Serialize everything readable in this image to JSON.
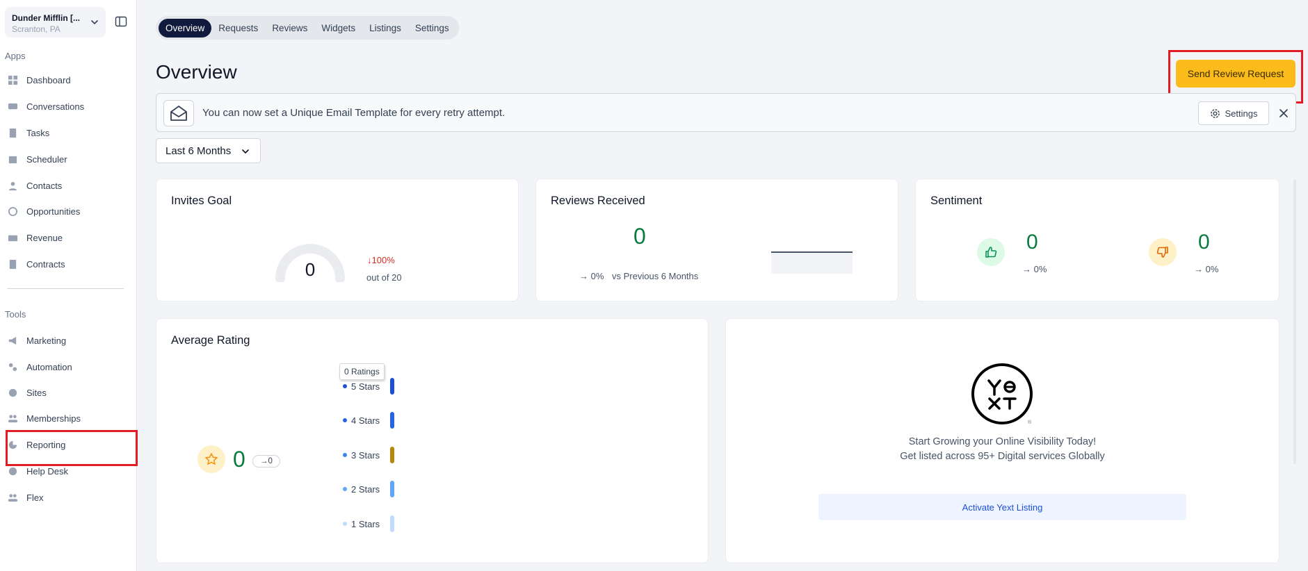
{
  "location": {
    "name": "Dunder Mifflin [...",
    "city": "Scranton, PA"
  },
  "sidebar": {
    "apps_label": "Apps",
    "tools_label": "Tools",
    "apps": [
      {
        "label": "Dashboard",
        "icon": "dashboard-icon"
      },
      {
        "label": "Conversations",
        "icon": "conversations-icon"
      },
      {
        "label": "Tasks",
        "icon": "tasks-icon"
      },
      {
        "label": "Scheduler",
        "icon": "calendar-icon"
      },
      {
        "label": "Contacts",
        "icon": "contacts-icon"
      },
      {
        "label": "Opportunities",
        "icon": "opportunities-icon"
      },
      {
        "label": "Revenue",
        "icon": "revenue-icon"
      },
      {
        "label": "Contracts",
        "icon": "contracts-icon"
      }
    ],
    "tools": [
      {
        "label": "Marketing",
        "icon": "megaphone-icon"
      },
      {
        "label": "Automation",
        "icon": "automation-icon"
      },
      {
        "label": "Sites",
        "icon": "sites-icon"
      },
      {
        "label": "Memberships",
        "icon": "memberships-icon"
      },
      {
        "label": "Reporting",
        "icon": "reporting-icon"
      },
      {
        "label": "Help Desk",
        "icon": "help-icon"
      },
      {
        "label": "Flex",
        "icon": "flex-icon"
      }
    ]
  },
  "tabs": [
    {
      "label": "Overview",
      "active": true
    },
    {
      "label": "Requests",
      "active": false
    },
    {
      "label": "Reviews",
      "active": false
    },
    {
      "label": "Widgets",
      "active": false
    },
    {
      "label": "Listings",
      "active": false
    },
    {
      "label": "Settings",
      "active": false
    }
  ],
  "page": {
    "title": "Overview",
    "send_button": "Send Review Request"
  },
  "banner": {
    "text": "You can now set a Unique Email Template for every retry attempt.",
    "settings_label": "Settings"
  },
  "range": {
    "selected": "Last 6 Months"
  },
  "invites": {
    "title": "Invites Goal",
    "value": "0",
    "trend": "100%",
    "out_of": "out of 20",
    "progress": 0
  },
  "reviews_received": {
    "title": "Reviews Received",
    "value": "0",
    "pct": "0%",
    "vs": "vs Previous 6 Months"
  },
  "sentiment": {
    "title": "Sentiment",
    "positive": {
      "value": "0",
      "pct": "0%"
    },
    "negative": {
      "value": "0",
      "pct": "0%"
    }
  },
  "average_rating": {
    "title": "Average Rating",
    "value": "0",
    "change": "0",
    "tooltip": "0 Ratings",
    "rows": [
      {
        "label": "5 Stars",
        "color": "#1d4ed8"
      },
      {
        "label": "4 Stars",
        "color": "#2563eb"
      },
      {
        "label": "3 Stars",
        "color": "#b8860b"
      },
      {
        "label": "2 Stars",
        "color": "#60a5fa"
      },
      {
        "label": "1 Stars",
        "color": "#bfdbfe"
      }
    ]
  },
  "yext": {
    "line1": "Start Growing your Online Visibility Today!",
    "line2": "Get listed across 95+ Digital services Globally",
    "button": "Activate Yext Listing"
  },
  "colors": {
    "accent": "#fbbc1b",
    "positive": "#0b7a3e",
    "negative_trend": "#d92d20",
    "tab_active": "#0f1a3d"
  }
}
